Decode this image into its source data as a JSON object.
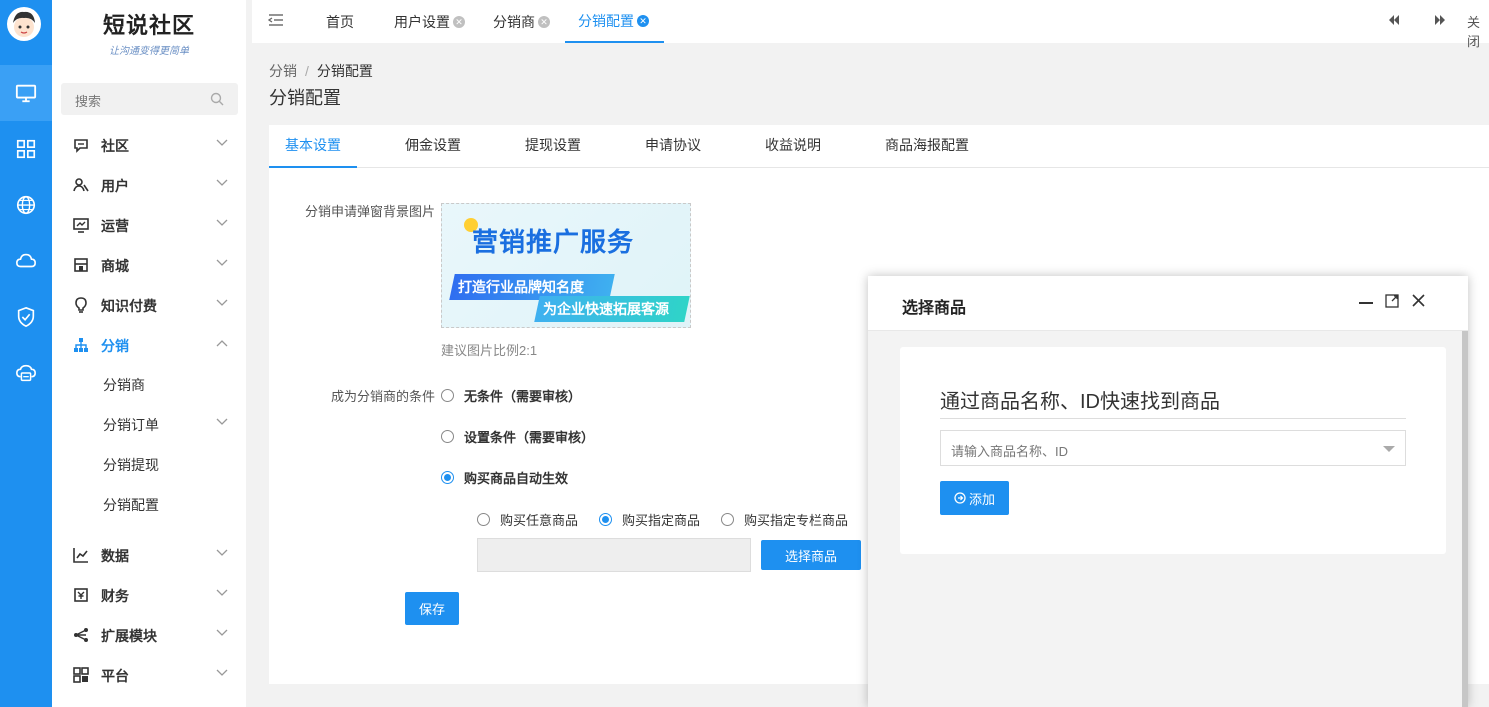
{
  "brand": {
    "title": "短说社区",
    "subtitle": "让沟通变得更简单"
  },
  "sidebar": {
    "search_placeholder": "搜索",
    "menu": [
      {
        "label": "社区",
        "icon": "chat-icon"
      },
      {
        "label": "用户",
        "icon": "users-icon"
      },
      {
        "label": "运营",
        "icon": "monitor-chart-icon"
      },
      {
        "label": "商城",
        "icon": "store-icon"
      },
      {
        "label": "知识付费",
        "icon": "bulb-icon"
      },
      {
        "label": "分销",
        "icon": "sitemap-icon"
      },
      {
        "label": "数据",
        "icon": "line-chart-icon"
      },
      {
        "label": "财务",
        "icon": "finance-icon"
      },
      {
        "label": "扩展模块",
        "icon": "share-icon"
      },
      {
        "label": "平台",
        "icon": "platform-icon"
      }
    ],
    "sub_menu": [
      "分销商",
      "分销订单",
      "分销提现",
      "分销配置"
    ]
  },
  "top_tabs": {
    "tabs": [
      {
        "label": "首页"
      },
      {
        "label": "用户设置"
      },
      {
        "label": "分销商"
      },
      {
        "label": "分销配置"
      }
    ],
    "close_label": "关闭"
  },
  "breadcrumb": {
    "parent": "分销",
    "separator": "/",
    "current": "分销配置"
  },
  "page_title": "分销配置",
  "content_tabs": [
    "基本设置",
    "佣金设置",
    "提现设置",
    "申请协议",
    "收益说明",
    "商品海报配置"
  ],
  "form": {
    "bg_image_label": "分销申请弹窗背景图片",
    "banner_title": "营销推广服务",
    "banner_line1": "打造行业品牌知名度",
    "banner_line2": "为企业快速拓展客源",
    "image_hint": "建议图片比例2:1",
    "condition_label": "成为分销商的条件",
    "conditions": [
      "无条件（需要审核）",
      "设置条件（需要审核）",
      "购买商品自动生效"
    ],
    "purchase_options": [
      "购买任意商品",
      "购买指定商品",
      "购买指定专栏商品"
    ],
    "select_goods_button": "选择商品",
    "save_button": "保存"
  },
  "modal": {
    "title": "选择商品",
    "heading": "通过商品名称、ID快速找到商品",
    "select_placeholder": "请输入商品名称、ID",
    "add_button": "添加"
  },
  "colors": {
    "primary": "#1e90f0",
    "rail": "#1e90f0"
  }
}
